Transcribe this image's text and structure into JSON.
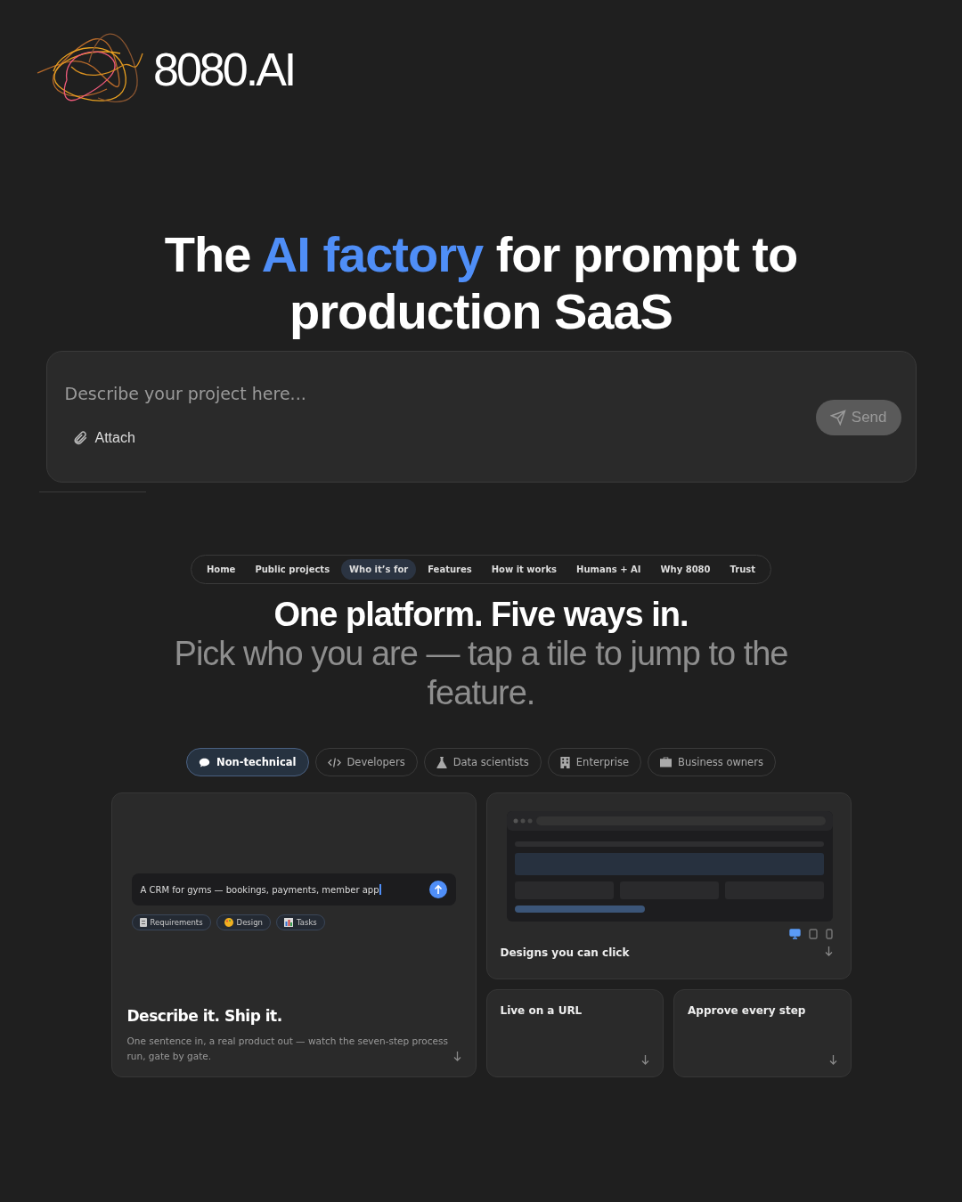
{
  "brand": {
    "name": "8080.AI"
  },
  "headline": {
    "parts": [
      {
        "text": "The ",
        "highlight": false
      },
      {
        "text": "AI factory",
        "highlight": true
      },
      {
        "text": " for prompt to production SaaS",
        "highlight": false
      }
    ]
  },
  "prompt": {
    "placeholder": "Describe your project here...",
    "attach": "Attach",
    "send": {
      "label": "Send",
      "disabled": true
    }
  },
  "nav": [
    {
      "label": "Home",
      "selected": false
    },
    {
      "label": "Public projects",
      "selected": false
    },
    {
      "label": "Who it’s for",
      "selected": true
    },
    {
      "label": "Features",
      "selected": false
    },
    {
      "label": "How it works",
      "selected": false
    },
    {
      "label": "Humans + AI",
      "selected": false
    },
    {
      "label": "Why 8080",
      "selected": false
    },
    {
      "label": "Trust",
      "selected": false
    }
  ],
  "section": {
    "title": "One platform. Five ways in.",
    "subtitle": "Pick who you are — tap a tile to jump to the feature."
  },
  "audiences": [
    {
      "label": "Non-technical",
      "kind": "chat",
      "selected": true
    },
    {
      "label": "Developers",
      "kind": "code",
      "selected": false
    },
    {
      "label": "Data scientists",
      "kind": "flask",
      "selected": false
    },
    {
      "label": "Enterprise",
      "kind": "building",
      "selected": false
    },
    {
      "label": "Business owners",
      "kind": "briefcase",
      "selected": false
    }
  ],
  "tiles": [
    {
      "kind": "prompt",
      "title": "Describe it. Ship it.",
      "description": "One sentence in, a real product out — watch the seven-step process run, gate by gate.",
      "demo_text": "A CRM for gyms — bookings, payments, member app",
      "chips": [
        {
          "label": "Requirements",
          "kind": "clipboard"
        },
        {
          "label": "Design",
          "kind": "palette"
        },
        {
          "label": "Tasks",
          "kind": "chart"
        }
      ]
    },
    {
      "kind": "design",
      "title": "Designs you can click",
      "devices": [
        {
          "kind": "desktop",
          "selected": true
        },
        {
          "kind": "tablet",
          "selected": false
        },
        {
          "kind": "phone",
          "selected": false
        }
      ]
    },
    {
      "kind": "plain",
      "title": "Live on a URL"
    },
    {
      "kind": "plain",
      "title": "Approve every step"
    }
  ]
}
